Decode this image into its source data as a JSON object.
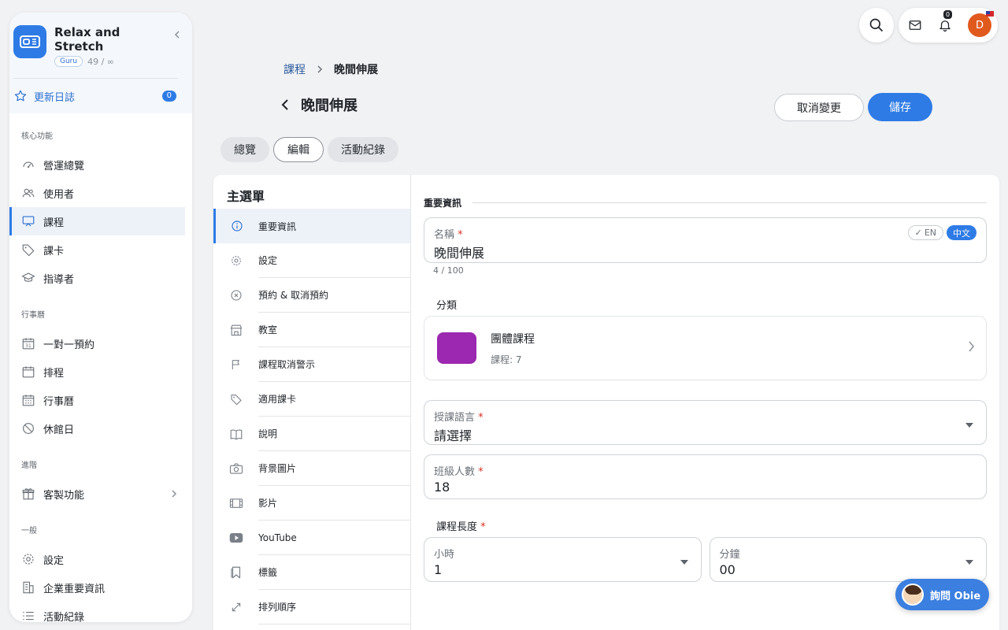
{
  "sidebar": {
    "brand_name": "Relax and Stretch",
    "tier_badge": "Guru",
    "quota": "49 / ∞",
    "changelog_label": "更新日誌",
    "changelog_count": "0",
    "groups": [
      {
        "label": "核心功能",
        "items": [
          {
            "label": "營運總覽",
            "icon": "dashboard-icon"
          },
          {
            "label": "使用者",
            "icon": "users-icon"
          },
          {
            "label": "課程",
            "icon": "presentation-icon",
            "active": true
          },
          {
            "label": "課卡",
            "icon": "tag-icon"
          },
          {
            "label": "指導者",
            "icon": "graduation-cap-icon"
          }
        ]
      },
      {
        "label": "行事曆",
        "items": [
          {
            "label": "一對一預約",
            "icon": "calendar-31-icon"
          },
          {
            "label": "排程",
            "icon": "calendar-icon"
          },
          {
            "label": "行事曆",
            "icon": "calendar-grid-icon"
          },
          {
            "label": "休館日",
            "icon": "ban-icon"
          }
        ]
      },
      {
        "label": "進階",
        "items": [
          {
            "label": "客製功能",
            "icon": "gift-icon"
          }
        ]
      },
      {
        "label": "一般",
        "items": [
          {
            "label": "設定",
            "icon": "gear-icon"
          },
          {
            "label": "企業重要資訊",
            "icon": "building-icon"
          },
          {
            "label": "活動紀錄",
            "icon": "list-icon"
          }
        ]
      }
    ]
  },
  "topbar": {
    "notification_count": "0",
    "avatar_initial": "D"
  },
  "breadcrumb": {
    "parent": "課程",
    "current": "晚間伸展"
  },
  "page": {
    "title": "晚間伸展",
    "cancel_label": "取消變更",
    "save_label": "儲存"
  },
  "tabs": [
    "總覽",
    "編輯",
    "活動紀錄"
  ],
  "menu": {
    "title": "主選單",
    "items": [
      {
        "label": "重要資訊",
        "icon": "info-icon",
        "active": true
      },
      {
        "label": "設定",
        "icon": "gear-icon"
      },
      {
        "label": "預約 & 取消預約",
        "icon": "cancel-circle-icon"
      },
      {
        "label": "教室",
        "icon": "store-icon"
      },
      {
        "label": "課程取消警示",
        "icon": "flag-icon"
      },
      {
        "label": "適用課卡",
        "icon": "tag-icon"
      },
      {
        "label": "說明",
        "icon": "book-icon"
      },
      {
        "label": "背景圖片",
        "icon": "camera-icon"
      },
      {
        "label": "影片",
        "icon": "film-icon"
      },
      {
        "label": "YouTube",
        "icon": "youtube-icon"
      },
      {
        "label": "標籤",
        "icon": "bookmark-icon"
      },
      {
        "label": "排列順序",
        "icon": "resize-arrows-icon"
      }
    ]
  },
  "form": {
    "section_title": "重要資訊",
    "name": {
      "label": "名稱",
      "value": "晚間伸展",
      "counter": "4 / 100",
      "lang_en": "EN",
      "lang_zh": "中文"
    },
    "category": {
      "label": "分類",
      "name": "團體課程",
      "count": "課程: 7",
      "color": "#9c27b0"
    },
    "language": {
      "label": "授課語言",
      "value": "請選擇"
    },
    "capacity": {
      "label": "班級人數",
      "value": "18"
    },
    "duration": {
      "label": "課程長度",
      "hours_label": "小時",
      "hours_value": "1",
      "minutes_label": "分鐘",
      "minutes_value": "00"
    }
  },
  "assistant": {
    "label": "詢問 Obie"
  },
  "colors": {
    "accent": "#2e7be6",
    "required": "#d93025"
  }
}
